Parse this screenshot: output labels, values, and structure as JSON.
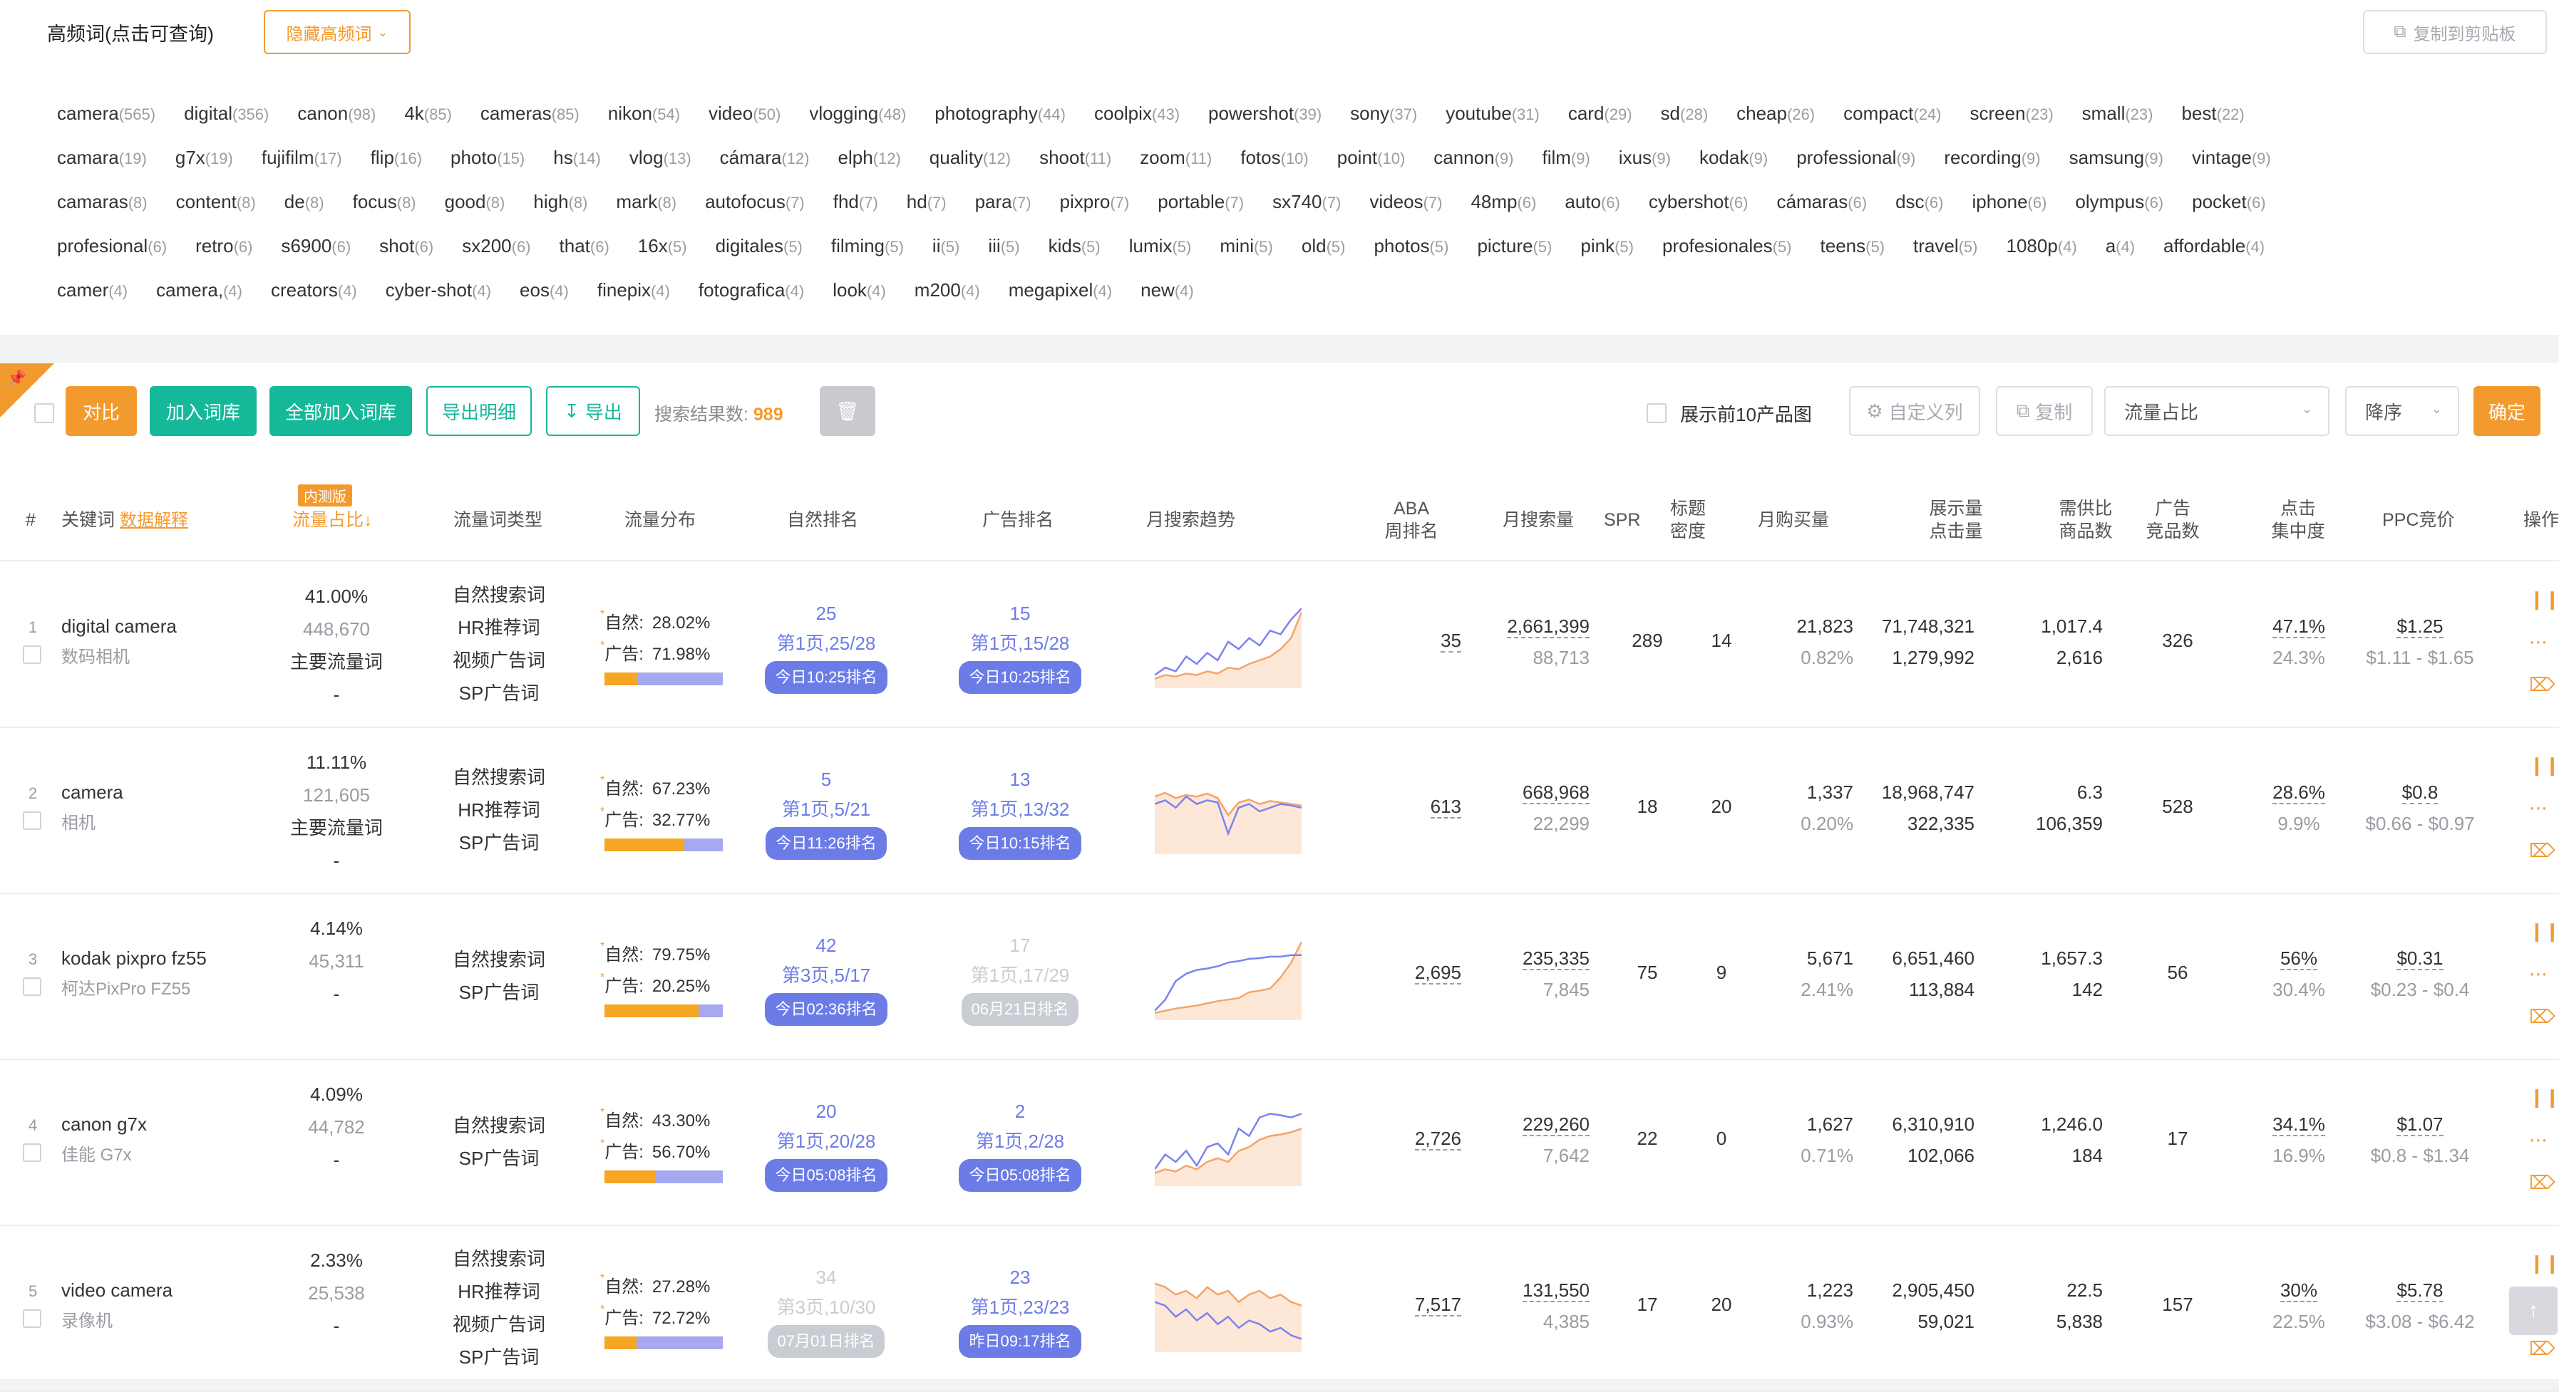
{
  "high_freq": {
    "title": "高频词(点击可查询)",
    "toggle_label": "隐藏高频词",
    "copy_label": "复制到剪贴板",
    "rows": [
      [
        [
          "camera",
          "(565)"
        ],
        [
          "digital",
          "(356)"
        ],
        [
          "canon",
          "(98)"
        ],
        [
          "4k",
          "(85)"
        ],
        [
          "cameras",
          "(85)"
        ],
        [
          "nikon",
          "(54)"
        ],
        [
          "video",
          "(50)"
        ],
        [
          "vlogging",
          "(48)"
        ],
        [
          "photography",
          "(44)"
        ],
        [
          "coolpix",
          "(43)"
        ],
        [
          "powershot",
          "(39)"
        ],
        [
          "sony",
          "(37)"
        ],
        [
          "youtube",
          "(31)"
        ],
        [
          "card",
          "(29)"
        ],
        [
          "sd",
          "(28)"
        ],
        [
          "cheap",
          "(26)"
        ],
        [
          "compact",
          "(24)"
        ],
        [
          "screen",
          "(23)"
        ],
        [
          "small",
          "(23)"
        ],
        [
          "best",
          "(22)"
        ]
      ],
      [
        [
          "camara",
          "(19)"
        ],
        [
          "g7x",
          "(19)"
        ],
        [
          "fujifilm",
          "(17)"
        ],
        [
          "flip",
          "(16)"
        ],
        [
          "photo",
          "(15)"
        ],
        [
          "hs",
          "(14)"
        ],
        [
          "vlog",
          "(13)"
        ],
        [
          "cámara",
          "(12)"
        ],
        [
          "elph",
          "(12)"
        ],
        [
          "quality",
          "(12)"
        ],
        [
          "shoot",
          "(11)"
        ],
        [
          "zoom",
          "(11)"
        ],
        [
          "fotos",
          "(10)"
        ],
        [
          "point",
          "(10)"
        ],
        [
          "cannon",
          "(9)"
        ],
        [
          "film",
          "(9)"
        ],
        [
          "ixus",
          "(9)"
        ],
        [
          "kodak",
          "(9)"
        ],
        [
          "professional",
          "(9)"
        ],
        [
          "recording",
          "(9)"
        ],
        [
          "samsung",
          "(9)"
        ],
        [
          "vintage",
          "(9)"
        ]
      ],
      [
        [
          "camaras",
          "(8)"
        ],
        [
          "content",
          "(8)"
        ],
        [
          "de",
          "(8)"
        ],
        [
          "focus",
          "(8)"
        ],
        [
          "good",
          "(8)"
        ],
        [
          "high",
          "(8)"
        ],
        [
          "mark",
          "(8)"
        ],
        [
          "autofocus",
          "(7)"
        ],
        [
          "fhd",
          "(7)"
        ],
        [
          "hd",
          "(7)"
        ],
        [
          "para",
          "(7)"
        ],
        [
          "pixpro",
          "(7)"
        ],
        [
          "portable",
          "(7)"
        ],
        [
          "sx740",
          "(7)"
        ],
        [
          "videos",
          "(7)"
        ],
        [
          "48mp",
          "(6)"
        ],
        [
          "auto",
          "(6)"
        ],
        [
          "cybershot",
          "(6)"
        ],
        [
          "cámaras",
          "(6)"
        ],
        [
          "dsc",
          "(6)"
        ],
        [
          "iphone",
          "(6)"
        ],
        [
          "olympus",
          "(6)"
        ],
        [
          "pocket",
          "(6)"
        ]
      ],
      [
        [
          "profesional",
          "(6)"
        ],
        [
          "retro",
          "(6)"
        ],
        [
          "s6900",
          "(6)"
        ],
        [
          "shot",
          "(6)"
        ],
        [
          "sx200",
          "(6)"
        ],
        [
          "that",
          "(6)"
        ],
        [
          "16x",
          "(5)"
        ],
        [
          "digitales",
          "(5)"
        ],
        [
          "filming",
          "(5)"
        ],
        [
          "ii",
          "(5)"
        ],
        [
          "iii",
          "(5)"
        ],
        [
          "kids",
          "(5)"
        ],
        [
          "lumix",
          "(5)"
        ],
        [
          "mini",
          "(5)"
        ],
        [
          "old",
          "(5)"
        ],
        [
          "photos",
          "(5)"
        ],
        [
          "picture",
          "(5)"
        ],
        [
          "pink",
          "(5)"
        ],
        [
          "profesionales",
          "(5)"
        ],
        [
          "teens",
          "(5)"
        ],
        [
          "travel",
          "(5)"
        ],
        [
          "1080p",
          "(4)"
        ],
        [
          "a",
          "(4)"
        ],
        [
          "affordable",
          "(4)"
        ]
      ],
      [
        [
          "camer",
          "(4)"
        ],
        [
          "camera,",
          "(4)"
        ],
        [
          "creators",
          "(4)"
        ],
        [
          "cyber-shot",
          "(4)"
        ],
        [
          "eos",
          "(4)"
        ],
        [
          "finepix",
          "(4)"
        ],
        [
          "fotografica",
          "(4)"
        ],
        [
          "look",
          "(4)"
        ],
        [
          "m200",
          "(4)"
        ],
        [
          "megapixel",
          "(4)"
        ],
        [
          "new",
          "(4)"
        ]
      ]
    ]
  },
  "toolbar": {
    "compare": "对比",
    "add_lib": "加入词库",
    "add_all_lib": "全部加入词库",
    "export_detail": "导出明细",
    "export": "导出",
    "result_label": "搜索结果数:",
    "result_count": "989",
    "show_top10": "展示前10产品图",
    "custom_cols": "自定义列",
    "copy": "复制",
    "sort_field": "流量占比",
    "sort_order": "降序",
    "confirm": "确定"
  },
  "headers": {
    "idx": "#",
    "keyword": "关键词",
    "explain": "数据解释",
    "beta": "内测版",
    "traffic_share": "流量占比↓",
    "traffic_type": "流量词类型",
    "traffic_dist": "流量分布",
    "natural_rank": "自然排名",
    "ad_rank": "广告排名",
    "trend": "月搜索趋势",
    "aba_1": "ABA",
    "aba_2": "周排名",
    "monthly_search": "月搜索量",
    "spr": "SPR",
    "title_1": "标题",
    "title_2": "密度",
    "monthly_buy": "月购买量",
    "imp_1": "展示量",
    "imp_2": "点击量",
    "supply_1": "需供比",
    "supply_2": "商品数",
    "ad_1": "广告",
    "ad_2": "竞品数",
    "click_1": "点击",
    "click_2": "集中度",
    "ppc": "PPC竞价",
    "ops": "操作"
  },
  "rows": [
    {
      "idx": "1",
      "kw": "digital camera",
      "kw_cn": "数码相机",
      "share": "41.00%",
      "share_num": "448,670",
      "share_type": "主要流量词",
      "dash": "-",
      "types": [
        "自然搜索词",
        "HR推荐词",
        "视频广告词",
        "SP广告词"
      ],
      "nat_label": "自然:",
      "nat": "28.02%",
      "ad_label": "广告:",
      "ad": "71.98%",
      "nat_frac": 0.2802,
      "nr": "25",
      "nr_page": "第1页,25/28",
      "nr_time": "今日10:25排名",
      "nr_gray": false,
      "ar": "15",
      "ar_page": "第1页,15/28",
      "ar_time": "今日10:25排名",
      "ar_gray": false,
      "aba": "35",
      "search": "2,661,399",
      "search2": "88,713",
      "spr": "289",
      "title": "14",
      "buy": "21,823",
      "buy2": "0.82%",
      "imp": "71,748,321",
      "clk": "1,279,992",
      "ratio": "1,017.4",
      "goods": "2,616",
      "adc": "326",
      "conc": "47.1%",
      "conc2": "24.3%",
      "ppc": "$1.25",
      "ppc_range": "$1.11 - $1.65",
      "trend_blue": [
        0.1,
        0.2,
        0.15,
        0.35,
        0.25,
        0.4,
        0.3,
        0.55,
        0.45,
        0.6,
        0.5,
        0.7,
        0.65,
        0.85,
        1.0
      ],
      "trend_orange": [
        0.05,
        0.1,
        0.08,
        0.12,
        0.1,
        0.15,
        0.12,
        0.2,
        0.18,
        0.25,
        0.3,
        0.35,
        0.45,
        0.6,
        0.95
      ]
    },
    {
      "idx": "2",
      "kw": "camera",
      "kw_cn": "相机",
      "share": "11.11%",
      "share_num": "121,605",
      "share_type": "主要流量词",
      "dash": "-",
      "types": [
        "自然搜索词",
        "HR推荐词",
        "SP广告词"
      ],
      "nat_label": "自然:",
      "nat": "67.23%",
      "ad_label": "广告:",
      "ad": "32.77%",
      "nat_frac": 0.6723,
      "nr": "5",
      "nr_page": "第1页,5/21",
      "nr_time": "今日11:26排名",
      "nr_gray": false,
      "ar": "13",
      "ar_page": "第1页,13/32",
      "ar_time": "今日10:15排名",
      "ar_gray": false,
      "aba": "613",
      "search": "668,968",
      "search2": "22,299",
      "spr": "18",
      "title": "20",
      "buy": "1,337",
      "buy2": "0.20%",
      "imp": "18,968,747",
      "clk": "322,335",
      "ratio": "6.3",
      "goods": "106,359",
      "adc": "528",
      "conc": "28.6%",
      "conc2": "9.9%",
      "ppc": "$0.8",
      "ppc_range": "$0.66 - $0.97",
      "trend_blue": [
        0.6,
        0.65,
        0.55,
        0.7,
        0.6,
        0.65,
        0.62,
        0.2,
        0.55,
        0.6,
        0.5,
        0.55,
        0.6,
        0.58,
        0.55
      ],
      "trend_orange": [
        0.7,
        0.75,
        0.68,
        0.72,
        0.7,
        0.74,
        0.68,
        0.45,
        0.62,
        0.66,
        0.6,
        0.64,
        0.62,
        0.6,
        0.58
      ]
    },
    {
      "idx": "3",
      "kw": "kodak pixpro fz55",
      "kw_cn": "柯达PixPro FZ55",
      "share": "4.14%",
      "share_num": "45,311",
      "share_type": "",
      "dash": "-",
      "types": [
        "自然搜索词",
        "SP广告词"
      ],
      "nat_label": "自然:",
      "nat": "79.75%",
      "ad_label": "广告:",
      "ad": "20.25%",
      "nat_frac": 0.7975,
      "nr": "42",
      "nr_page": "第3页,5/17",
      "nr_time": "今日02:36排名",
      "nr_gray": false,
      "ar": "17",
      "ar_page": "第1页,17/29",
      "ar_time": "06月21日排名",
      "ar_gray": true,
      "aba": "2,695",
      "search": "235,335",
      "search2": "7,845",
      "spr": "75",
      "title": "9",
      "buy": "5,671",
      "buy2": "2.41%",
      "imp": "6,651,460",
      "clk": "113,884",
      "ratio": "1,657.3",
      "goods": "142",
      "adc": "56",
      "conc": "56%",
      "conc2": "30.4%",
      "ppc": "$0.31",
      "ppc_range": "$0.23 - $0.4",
      "trend_blue": [
        0.05,
        0.2,
        0.45,
        0.55,
        0.6,
        0.62,
        0.65,
        0.7,
        0.72,
        0.75,
        0.76,
        0.78,
        0.78,
        0.8,
        0.8
      ],
      "trend_orange": [
        0.02,
        0.05,
        0.08,
        0.1,
        0.12,
        0.15,
        0.18,
        0.2,
        0.22,
        0.3,
        0.32,
        0.35,
        0.5,
        0.7,
        0.98
      ]
    },
    {
      "idx": "4",
      "kw": "canon g7x",
      "kw_cn": "佳能 G7x",
      "share": "4.09%",
      "share_num": "44,782",
      "share_type": "",
      "dash": "-",
      "types": [
        "自然搜索词",
        "SP广告词"
      ],
      "nat_label": "自然:",
      "nat": "43.30%",
      "ad_label": "广告:",
      "ad": "56.70%",
      "nat_frac": 0.433,
      "nr": "20",
      "nr_page": "第1页,20/28",
      "nr_time": "今日05:08排名",
      "nr_gray": false,
      "ar": "2",
      "ar_page": "第1页,2/28",
      "ar_time": "今日05:08排名",
      "ar_gray": false,
      "aba": "2,726",
      "search": "229,260",
      "search2": "7,642",
      "spr": "22",
      "title": "0",
      "buy": "1,627",
      "buy2": "0.71%",
      "imp": "6,310,910",
      "clk": "102,066",
      "ratio": "1,246.0",
      "goods": "184",
      "adc": "17",
      "conc": "34.1%",
      "conc2": "16.9%",
      "ppc": "$1.07",
      "ppc_range": "$0.8 - $1.34",
      "trend_blue": [
        0.15,
        0.35,
        0.25,
        0.4,
        0.2,
        0.45,
        0.5,
        0.35,
        0.7,
        0.6,
        0.85,
        0.9,
        0.88,
        0.85,
        0.9
      ],
      "trend_orange": [
        0.1,
        0.15,
        0.12,
        0.2,
        0.15,
        0.25,
        0.3,
        0.25,
        0.4,
        0.45,
        0.55,
        0.6,
        0.62,
        0.65,
        0.7
      ]
    },
    {
      "idx": "5",
      "kw": "video camera",
      "kw_cn": "录像机",
      "share": "2.33%",
      "share_num": "25,538",
      "share_type": "",
      "dash": "-",
      "types": [
        "自然搜索词",
        "HR推荐词",
        "视频广告词",
        "SP广告词"
      ],
      "nat_label": "自然:",
      "nat": "27.28%",
      "ad_label": "广告:",
      "ad": "72.72%",
      "nat_frac": 0.2728,
      "nr": "34",
      "nr_page": "第3页,10/30",
      "nr_time": "07月01日排名",
      "nr_gray": true,
      "ar": "23",
      "ar_page": "第1页,23/23",
      "ar_time": "昨日09:17排名",
      "ar_gray": false,
      "aba": "7,517",
      "search": "131,550",
      "search2": "4,385",
      "spr": "17",
      "title": "20",
      "buy": "1,223",
      "buy2": "0.93%",
      "imp": "2,905,450",
      "clk": "59,021",
      "ratio": "22.5",
      "goods": "5,838",
      "adc": "157",
      "conc": "30%",
      "conc2": "22.5%",
      "ppc": "$5.78",
      "ppc_range": "$3.08 - $6.42",
      "trend_blue": [
        0.6,
        0.55,
        0.4,
        0.5,
        0.35,
        0.45,
        0.3,
        0.4,
        0.25,
        0.35,
        0.3,
        0.2,
        0.25,
        0.15,
        0.1
      ],
      "trend_orange": [
        0.85,
        0.8,
        0.7,
        0.75,
        0.65,
        0.8,
        0.7,
        0.75,
        0.6,
        0.7,
        0.75,
        0.65,
        0.7,
        0.6,
        0.55
      ]
    }
  ],
  "colors": {
    "accent": "#f39a2f",
    "green": "#15b99a",
    "blue": "#6c7ce7",
    "trend_blue": "#7d82f0",
    "trend_orange": "#f5a36a"
  }
}
